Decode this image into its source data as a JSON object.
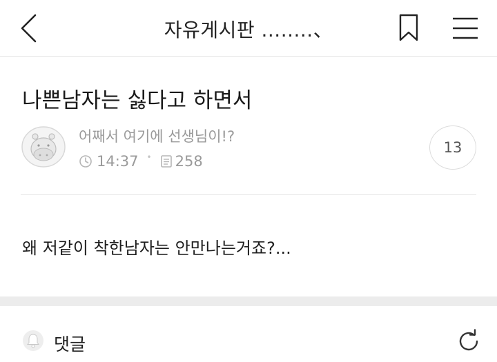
{
  "header": {
    "board_title": "자유게시판 ........、",
    "back_icon": "chevron-left-icon",
    "bookmark_icon": "bookmark-icon",
    "menu_icon": "hamburger-menu-icon"
  },
  "post": {
    "title": "나쁜남자는 싫다고 하면서",
    "author": "어째서 여기에 선생님이!?",
    "time": "14:37",
    "views": "258",
    "comment_count": "13",
    "body": "왜 저같이 착한남자는 안만나는거죠?..."
  },
  "comments": {
    "label": "댓글",
    "bell_icon": "bell-icon",
    "refresh_icon": "refresh-icon"
  }
}
